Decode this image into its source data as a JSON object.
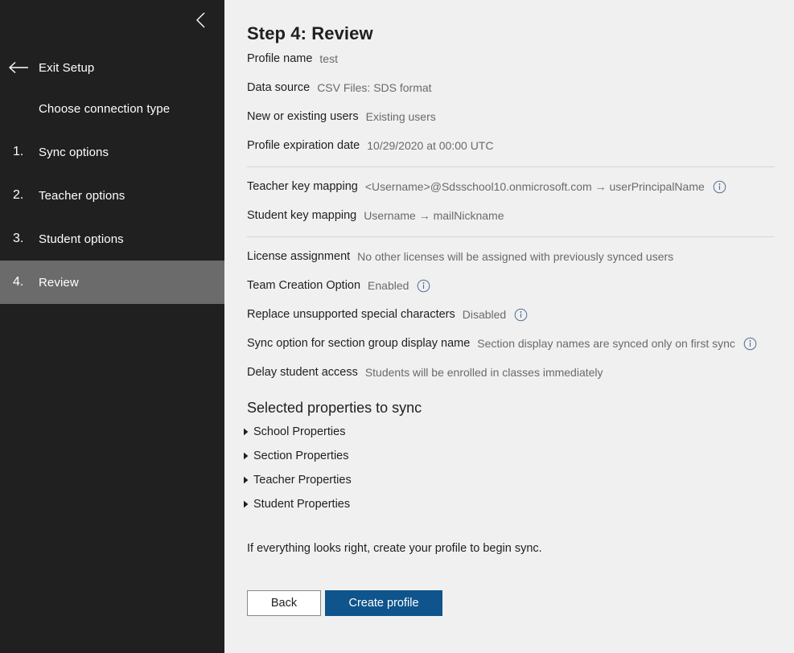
{
  "sidebar": {
    "collapse_icon": "chevron-left-icon",
    "exit": {
      "label": "Exit Setup",
      "icon": "arrow-left-icon"
    },
    "items": [
      {
        "num": "",
        "label": "Choose connection type",
        "selected": false
      },
      {
        "num": "1.",
        "label": "Sync options",
        "selected": false
      },
      {
        "num": "2.",
        "label": "Teacher options",
        "selected": false
      },
      {
        "num": "3.",
        "label": "Student options",
        "selected": false
      },
      {
        "num": "4.",
        "label": "Review",
        "selected": true
      }
    ],
    "colors": {
      "background": "#202020",
      "selected": "#6b6b6b",
      "text": "#ffffff"
    }
  },
  "main": {
    "title": "Step 4: Review",
    "group1": [
      {
        "label": "Profile name",
        "value": "test",
        "info": false
      },
      {
        "label": "Data source",
        "value": "CSV Files: SDS format",
        "info": false
      },
      {
        "label": "New or existing users",
        "value": "Existing users",
        "info": false
      },
      {
        "label": "Profile expiration date",
        "value": "10/29/2020 at 00:00 UTC",
        "info": false
      }
    ],
    "group2": [
      {
        "label": "Teacher key mapping",
        "value": "<Username>@Sdsschool10.onmicrosoft.com → userPrincipalName",
        "info": true
      },
      {
        "label": "Student key mapping",
        "value": "Username → mailNickname",
        "info": false
      }
    ],
    "group3": [
      {
        "label": "License assignment",
        "value": "No other licenses will be assigned with previously synced users",
        "info": false
      },
      {
        "label": "Team Creation Option",
        "value": "Enabled",
        "info": true
      },
      {
        "label": "Replace unsupported special characters",
        "value": "Disabled",
        "info": true
      },
      {
        "label": "Sync option for section group display name",
        "value": "Section display names are synced only on first sync",
        "info": true
      },
      {
        "label": "Delay student access",
        "value": "Students will be enrolled in classes immediately",
        "info": false
      }
    ],
    "properties_heading": "Selected properties to sync",
    "properties": [
      {
        "label": "School Properties",
        "icon": "caret-right-icon"
      },
      {
        "label": "Section Properties",
        "icon": "caret-right-icon"
      },
      {
        "label": "Teacher Properties",
        "icon": "caret-right-icon"
      },
      {
        "label": "Student Properties",
        "icon": "caret-right-icon"
      }
    ],
    "hint": "If everything looks right, create your profile to begin sync.",
    "buttons": {
      "back": "Back",
      "create": "Create profile",
      "primary_color": "#0f548c"
    }
  }
}
